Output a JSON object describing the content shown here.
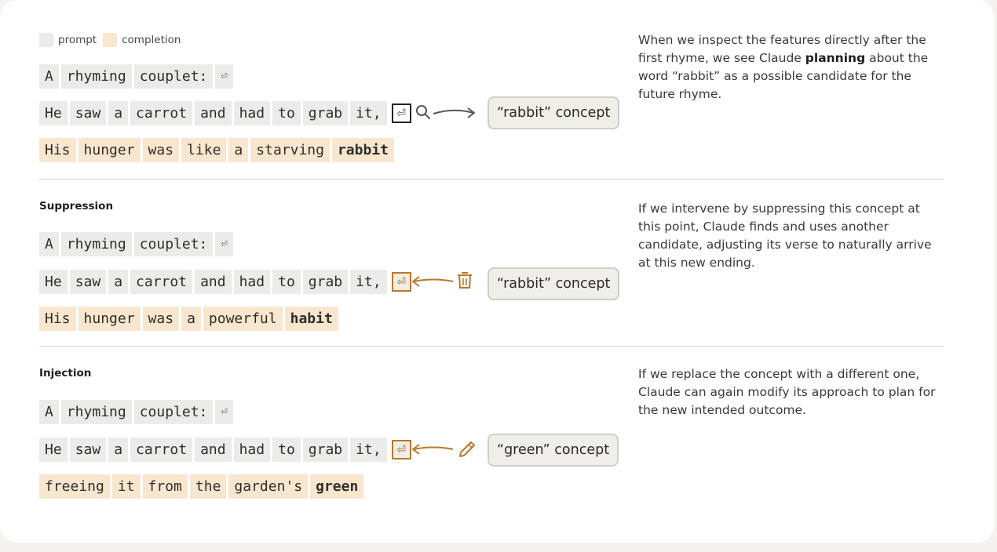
{
  "legend": {
    "prompt": "prompt",
    "completion": "completion"
  },
  "return_glyph": "⏎",
  "sections": [
    {
      "heading": "",
      "prompt_line1": [
        "A",
        "rhyming",
        "couplet:"
      ],
      "prompt_line2": [
        "He",
        "saw",
        "a",
        "carrot",
        "and",
        "had",
        "to",
        "grab",
        "it,"
      ],
      "completion": [
        "His",
        "hunger",
        "was",
        "like",
        "a",
        "starving"
      ],
      "completion_final": "rabbit",
      "concept": "“rabbit” concept",
      "action_icon": "search-icon",
      "desc_pre": "When we inspect the features directly after the first rhyme, we see Claude",
      "desc_bold": "planning",
      "desc_post": "about the word “rabbit” as a possible candidate for the future rhyme."
    },
    {
      "heading": "Suppression",
      "prompt_line1": [
        "A",
        "rhyming",
        "couplet:"
      ],
      "prompt_line2": [
        "He",
        "saw",
        "a",
        "carrot",
        "and",
        "had",
        "to",
        "grab",
        "it,"
      ],
      "completion": [
        "His",
        "hunger",
        "was",
        "a",
        "powerful"
      ],
      "completion_final": "habit",
      "concept": "“rabbit” concept",
      "action_icon": "trash-icon",
      "desc": "If we intervene by suppressing this concept at this point, Claude finds and uses another candidate, adjusting its verse to naturally arrive at this new ending."
    },
    {
      "heading": "Injection",
      "prompt_line1": [
        "A",
        "rhyming",
        "couplet:"
      ],
      "prompt_line2": [
        "He",
        "saw",
        "a",
        "carrot",
        "and",
        "had",
        "to",
        "grab",
        "it,"
      ],
      "completion": [
        "freeing",
        "it",
        "from",
        "the",
        "garden's"
      ],
      "completion_final": "green",
      "concept": "“green” concept",
      "action_icon": "pencil-icon",
      "desc": "If we replace the concept with a different one, Claude can again modify its approach to plan for the new intended outcome."
    }
  ],
  "colors": {
    "prompt_token": "#ebebea",
    "completion_token": "#f8e6cf",
    "accent": "#b8782a",
    "concept_bg": "#efeee8"
  }
}
